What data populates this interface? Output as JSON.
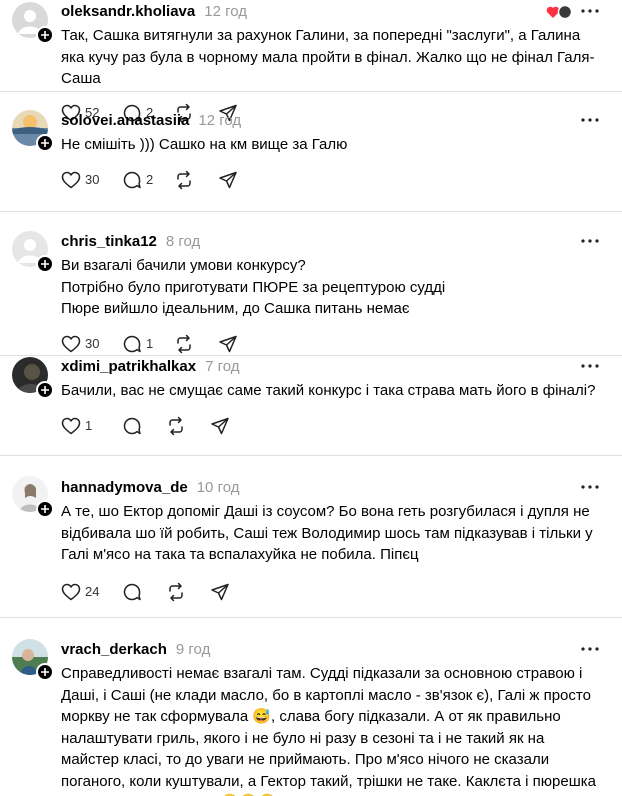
{
  "posts": [
    {
      "user": "oleksandr.kholiava",
      "time": "12 год",
      "avatar_icon": "user-silhouette",
      "lines": [
        "Так, Сашка витягнули за рахунок Галини, за попередні \"заслуги\", а Галина яка кучу раз була в чорному мала пройти в фінал. Жалко що не фінал Галя-Саша"
      ],
      "likes": "52",
      "replies": "2",
      "reposts": "",
      "liked_by_icon": "heart-icon"
    },
    {
      "user": "solovei.anastasiia",
      "time": "12 год",
      "avatar_icon": "landscape-photo",
      "lines": [
        "Не смішіть ))) Сашко на км вище за Галю"
      ],
      "likes": "30",
      "replies": "2",
      "reposts": ""
    },
    {
      "user": "chris_tinka12",
      "time": "8 год",
      "avatar_icon": "default-avatar",
      "lines": [
        "Ви взагалі бачили умови конкурсу?",
        "Потрібно було приготувати ПЮРЕ за рецептурою судді",
        "Пюре вийшло ідеальним, до Сашка питань немає"
      ],
      "likes": "30",
      "replies": "1",
      "reposts": ""
    },
    {
      "user": "xdimi_patrikhalkax",
      "time": "7 год",
      "avatar_icon": "dark-photo",
      "lines": [
        "Бачили, вас не смущає саме такий конкурс і така страва мать його в фіналі?"
      ],
      "likes": "1",
      "replies": "",
      "reposts": ""
    },
    {
      "user": "hannadymova_de",
      "time": "10 год",
      "avatar_icon": "portrait-photo",
      "lines": [
        "А те, шо Ектор допоміг Даші із соусом? Бо вона геть розгубилася і дупля не відбивала шо їй робить, Саші теж Володимир шось там підказував і тільки у Галі м'ясо на така та вспалахуйка не побила. Піпєц"
      ],
      "likes": "24",
      "replies": "",
      "reposts": ""
    },
    {
      "user": "vrach_derkach",
      "time": "9 год",
      "avatar_icon": "outdoor-photo",
      "lines": [
        "Справедливості немає взагалі там. Судді підказали за основною стравою і Даші, і Саші (не клади масло, бо в картоплі масло - зв'язок є), Галі ж просто моркву не так сформувала 😅, слава богу підказали. А от як правильно налаштувати гриль, якого і не було ні разу в сезоні та і не такий як на майстер класі, то до уваги не приймають. Про м'ясо нічого не сказали поганого, коли куштували, а Гектор такий, трішки не таке. Каклєта і пюрешка чи макарони ентонсес 🤣🤣🤣"
      ],
      "likes": "",
      "replies": "",
      "reposts": ""
    }
  ],
  "colors": {
    "text": "#000000",
    "muted": "#999999",
    "divider": "#e0e0e0",
    "accent_heart": "#ff3040"
  }
}
